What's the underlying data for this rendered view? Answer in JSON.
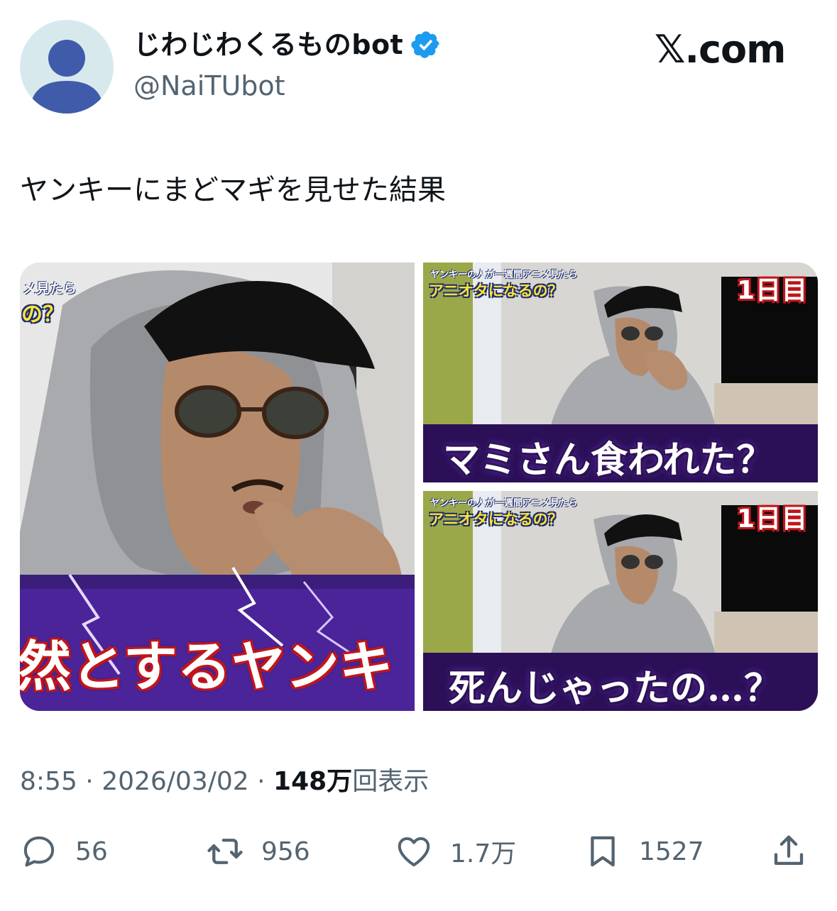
{
  "author": {
    "display_name": "じわじわくるものbot",
    "handle": "@NaiTUbot",
    "verified": true,
    "avatar_icon": "default-avatar-icon"
  },
  "brand": "𝕏.com",
  "post": {
    "text": "ヤンキーにまどマギを見せた結果"
  },
  "media": {
    "left": {
      "tele_small": "メ見たら",
      "tele_big": "の？",
      "caption": "然とするヤンキ"
    },
    "top_right": {
      "tele_small": "ヤンキーの人が一週間アニメ見たら",
      "tele_big": "アニオタになるの？",
      "day_badge": "1日目",
      "caption": "マミさん食われた？"
    },
    "bottom_right": {
      "tele_small": "ヤンキーの人が一週間アニメ見たら",
      "tele_big": "アニオタになるの？",
      "day_badge": "1日目",
      "caption": "死んじゃったの…？"
    }
  },
  "meta": {
    "time": "8:55",
    "sep1": " · ",
    "date": "2026/03/02",
    "sep2": " · ",
    "views_count": "148万",
    "views_label": "回表示"
  },
  "actions": {
    "reply": {
      "icon": "reply-icon",
      "count": "56"
    },
    "repost": {
      "icon": "repost-icon",
      "count": "956"
    },
    "like": {
      "icon": "heart-icon",
      "count": "1.7万"
    },
    "bookmark": {
      "icon": "bookmark-icon",
      "count": "1527"
    },
    "share": {
      "icon": "share-icon"
    }
  },
  "colors": {
    "text_primary": "#0f1419",
    "text_secondary": "#536471",
    "verified_blue": "#1d9bf0",
    "avatar_bg": "#d8e9ee",
    "avatar_fg": "#3f5ba9"
  }
}
